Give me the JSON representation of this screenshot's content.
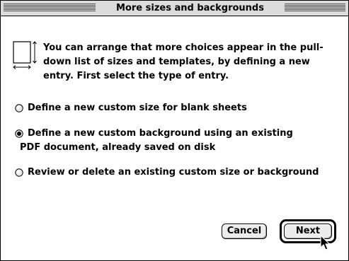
{
  "window": {
    "title": "More sizes and backgrounds"
  },
  "intro": {
    "text": "You can arrange that more choices appear in the pull-down list of sizes and templates, by defining a new entry. First select the type of entry."
  },
  "options": [
    {
      "label": "Define a new custom size for blank sheets",
      "selected": false
    },
    {
      "label": "Define a new custom background using an existing",
      "label2": "PDF document, already saved on disk",
      "selected": true
    },
    {
      "label": "Review or delete an existing custom size or background",
      "selected": false
    }
  ],
  "buttons": {
    "cancel": "Cancel",
    "next": "Next"
  },
  "icons": {
    "doc": "page-size-icon",
    "cursor": "arrow-cursor-icon"
  }
}
